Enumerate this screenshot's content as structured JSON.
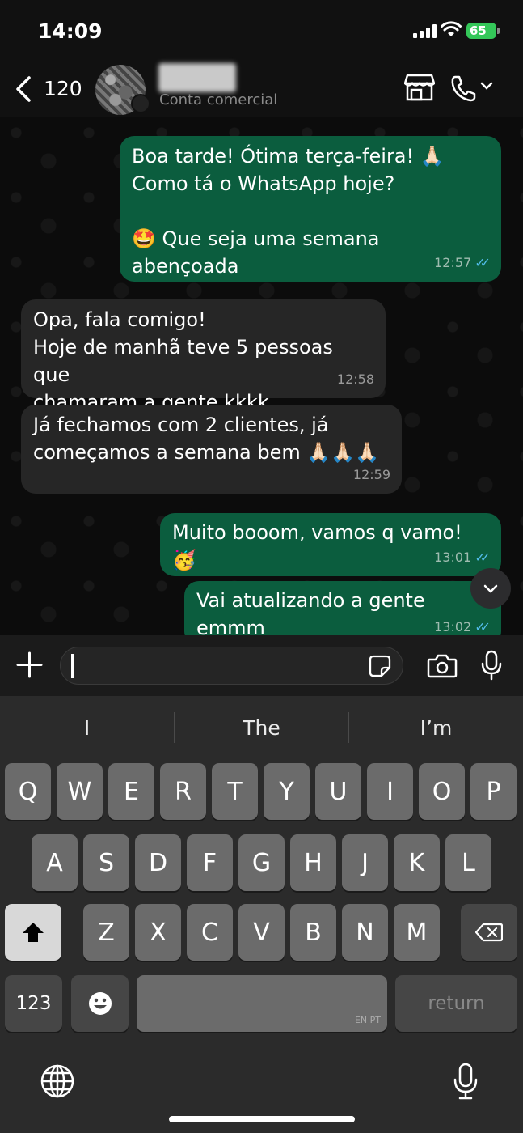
{
  "status": {
    "time": "14:09",
    "battery": "65"
  },
  "header": {
    "back_count": "120",
    "subtitle": "Conta comercial"
  },
  "messages": [
    {
      "dir": "out",
      "text": "Boa tarde! Ótima terça-feira! 🙏🏻\nComo tá o WhatsApp hoje?\n\n🤩 Que seja uma semana abençoada",
      "time": "12:57"
    },
    {
      "dir": "in",
      "text": "Opa, fala comigo!\nHoje de manhã teve 5 pessoas que\nchamaram a gente kkkk",
      "time": "12:58"
    },
    {
      "dir": "in",
      "text": "Já fechamos com 2 clientes, já\ncomeçamos a semana bem 🙏🏻🙏🏻🙏🏻",
      "time": "12:59"
    },
    {
      "dir": "out",
      "text": "Muito booom, vamos q vamo! 🥳",
      "time": "13:01"
    },
    {
      "dir": "out",
      "text": "Vai atualizando a gente emmm",
      "time": "13:02"
    }
  ],
  "keyboard": {
    "suggestions": [
      "I",
      "The",
      "I’m"
    ],
    "row1": [
      "Q",
      "W",
      "E",
      "R",
      "T",
      "Y",
      "U",
      "I",
      "O",
      "P"
    ],
    "row2": [
      "A",
      "S",
      "D",
      "F",
      "G",
      "H",
      "J",
      "K",
      "L"
    ],
    "row3": [
      "Z",
      "X",
      "C",
      "V",
      "B",
      "N",
      "M"
    ],
    "numbers_key": "123",
    "space_lang": "EN PT",
    "return_key": "return"
  }
}
